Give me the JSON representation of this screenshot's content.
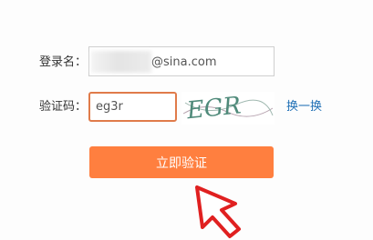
{
  "form": {
    "username_label": "登录名：",
    "username_domain": "@sina.com",
    "captcha_label": "验证码：",
    "captcha_value": "eg3r",
    "captcha_image_text": "EGR",
    "refresh_label": "换一换",
    "verify_button_label": "立即验证"
  },
  "icons": {
    "pointer": "arrow-pointer-icon"
  },
  "colors": {
    "accent": "#ff7f3f",
    "input_focus_border": "#e07b4a",
    "link": "#1f6fb5",
    "arrow": "#e02020"
  }
}
